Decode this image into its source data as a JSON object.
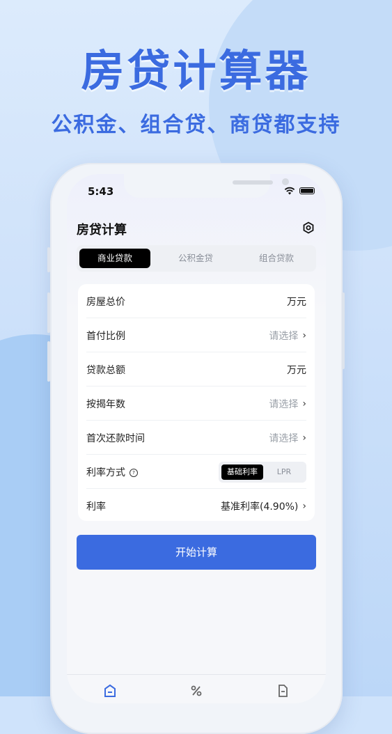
{
  "promo": {
    "headline": "房贷计算器",
    "subline": "公积金、组合贷、商贷都支持"
  },
  "status_bar": {
    "time": "5:43"
  },
  "app": {
    "title": "房贷计算",
    "settings_icon": "settings-hexagon-icon",
    "tabs": [
      {
        "label": "商业贷款",
        "active": true
      },
      {
        "label": "公积金贷",
        "active": false
      },
      {
        "label": "组合贷款",
        "active": false
      }
    ],
    "form": {
      "rows": [
        {
          "label": "房屋总价",
          "value": "万元"
        },
        {
          "label": "首付比例",
          "value": "请选择"
        },
        {
          "label": "贷款总额",
          "value": "万元"
        },
        {
          "label": "按揭年数",
          "value": "请选择"
        },
        {
          "label": "首次还款时间",
          "value": "请选择"
        },
        {
          "label": "利率方式",
          "options": [
            "基础利率",
            "LPR"
          ],
          "selected": "基础利率"
        },
        {
          "label": "利率",
          "value": "基准利率(4.90%)"
        }
      ]
    },
    "submit_label": "开始计算",
    "bottom_tabs": [
      {
        "icon": "home-icon",
        "active": true
      },
      {
        "icon": "percent-icon",
        "active": false
      },
      {
        "icon": "document-icon",
        "active": false
      }
    ]
  },
  "colors": {
    "accent": "#3b6be0",
    "tab_active_bg": "#000000",
    "placeholder": "#9aa0a8"
  }
}
